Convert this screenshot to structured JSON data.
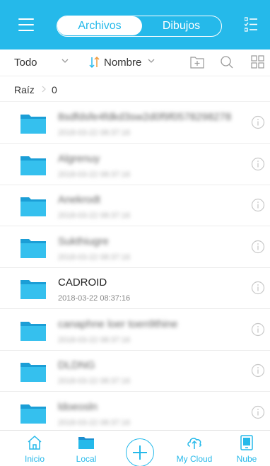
{
  "header": {
    "tabs": [
      {
        "label": "Archivos",
        "active": true
      },
      {
        "label": "Dibujos",
        "active": false
      }
    ],
    "accent_color": "#25b9ea",
    "menu_icon": "menu-icon",
    "select_icon": "checklist-icon"
  },
  "toolbar": {
    "filter_label": "Todo",
    "sort_label": "Nombre",
    "icons": [
      "new-folder-icon",
      "search-icon",
      "grid-view-icon"
    ]
  },
  "breadcrumb": {
    "root": "Raíz",
    "count": "0"
  },
  "files": [
    {
      "name": "8sdfdsfe4fdkd3sw2d0f9f0578298278",
      "date": "2018-03-22 08:37:16",
      "blurred": true
    },
    {
      "name": "Algrenuy",
      "date": "2018-03-22 08:37:16",
      "blurred": true
    },
    {
      "name": "Anekrodt",
      "date": "2018-03-22 08:37:16",
      "blurred": true
    },
    {
      "name": "Sukthiugre",
      "date": "2018-03-22 08:37:16",
      "blurred": true
    },
    {
      "name": "CADROID",
      "date": "2018-03-22 08:37:16",
      "blurred": false
    },
    {
      "name": "canaphne loer toen9thine",
      "date": "2018-03-22 08:37:16",
      "blurred": true
    },
    {
      "name": "DLDNG",
      "date": "2018-03-22 08:37:16",
      "blurred": true
    },
    {
      "name": "ldoeosln",
      "date": "2018-03-22 08:37:16",
      "blurred": true
    }
  ],
  "bottom_nav": [
    {
      "label": "Inicio",
      "icon": "home-icon"
    },
    {
      "label": "Local",
      "icon": "folder-icon"
    },
    {
      "label": "My Cloud",
      "icon": "cloud-upload-icon"
    },
    {
      "label": "Nube",
      "icon": "tablet-icon"
    }
  ]
}
